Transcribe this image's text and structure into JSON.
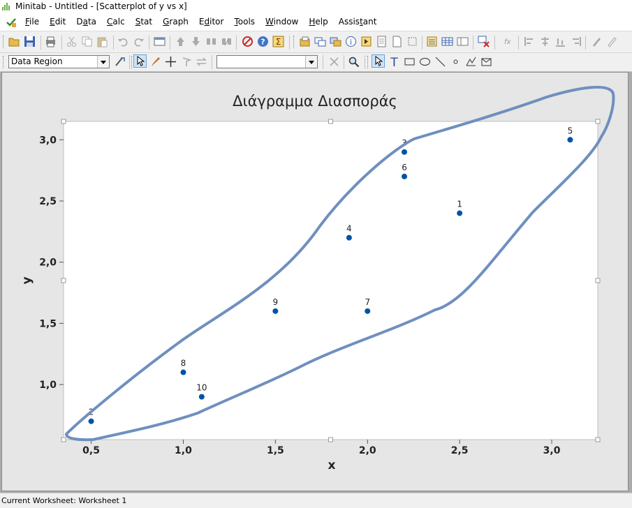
{
  "window": {
    "title": "Minitab - Untitled - [Scatterplot of y vs x]"
  },
  "menu": [
    {
      "pre": "",
      "u": "F",
      "post": "ile"
    },
    {
      "pre": "",
      "u": "E",
      "post": "dit"
    },
    {
      "pre": "D",
      "u": "a",
      "post": "ta"
    },
    {
      "pre": "",
      "u": "C",
      "post": "alc"
    },
    {
      "pre": "",
      "u": "S",
      "post": "tat"
    },
    {
      "pre": "",
      "u": "G",
      "post": "raph"
    },
    {
      "pre": "E",
      "u": "d",
      "post": "itor"
    },
    {
      "pre": "",
      "u": "T",
      "post": "ools"
    },
    {
      "pre": "",
      "u": "W",
      "post": "indow"
    },
    {
      "pre": "",
      "u": "H",
      "post": "elp"
    },
    {
      "pre": "Assis",
      "u": "t",
      "post": "ant"
    }
  ],
  "toolbar2": {
    "region_select": "Data Region",
    "second_select": ""
  },
  "status": {
    "text": "Current Worksheet: Worksheet 1"
  },
  "colors": {
    "marker": "#0054a6",
    "annotation": "#6f8fbf",
    "graph_bg": "#e6e6e6"
  },
  "chart_data": {
    "type": "scatter",
    "title": "Διάγραμμα Διασποράς",
    "xlabel": "x",
    "ylabel": "y",
    "xlim": [
      0.35,
      3.25
    ],
    "ylim": [
      0.55,
      3.15
    ],
    "xticks": [
      "0,5",
      "1,0",
      "1,5",
      "2,0",
      "2,5",
      "3,0"
    ],
    "yticks": [
      "1,0",
      "1,5",
      "2,0",
      "2,5",
      "3,0"
    ],
    "points": [
      {
        "label": "1",
        "x": 2.5,
        "y": 2.4
      },
      {
        "label": "2",
        "x": 0.5,
        "y": 0.7
      },
      {
        "label": "3",
        "x": 2.2,
        "y": 2.9
      },
      {
        "label": "4",
        "x": 1.9,
        "y": 2.2
      },
      {
        "label": "5",
        "x": 3.1,
        "y": 3.0
      },
      {
        "label": "6",
        "x": 2.2,
        "y": 2.7
      },
      {
        "label": "7",
        "x": 2.0,
        "y": 1.6
      },
      {
        "label": "8",
        "x": 1.0,
        "y": 1.1
      },
      {
        "label": "9",
        "x": 1.5,
        "y": 1.6
      },
      {
        "label": "10",
        "x": 1.1,
        "y": 0.9
      }
    ]
  }
}
